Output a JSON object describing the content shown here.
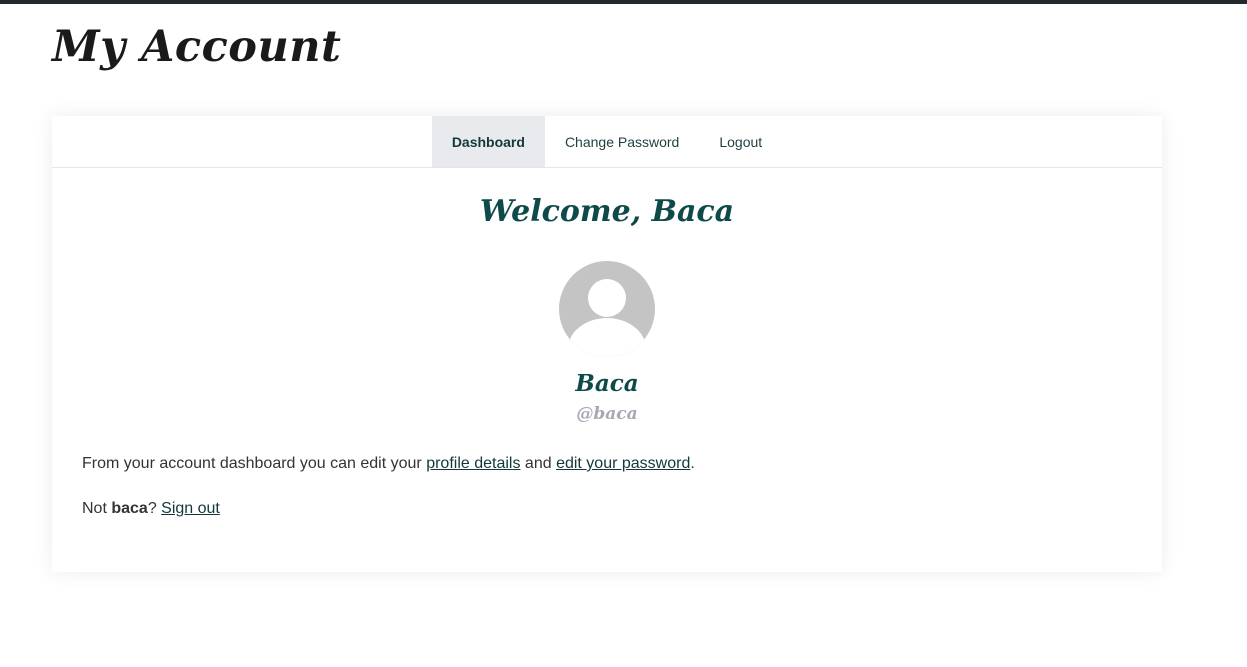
{
  "page": {
    "title": "My Account"
  },
  "tabs": [
    {
      "label": "Dashboard",
      "active": true
    },
    {
      "label": "Change Password",
      "active": false
    },
    {
      "label": "Logout",
      "active": false
    }
  ],
  "dashboard": {
    "welcome": "Welcome, Baca",
    "avatar_icon": "default-user-avatar-icon",
    "display_name": "Baca",
    "username": "@baca",
    "intro_before": "From your account dashboard you can edit your ",
    "profile_link": "profile details",
    "intro_middle": " and ",
    "password_link": "edit your password",
    "intro_after": ".",
    "not_prefix": "Not ",
    "not_user": "baca",
    "not_suffix": "? ",
    "signout_link": "Sign out"
  },
  "colors": {
    "accent": "#0f4a4a",
    "link": "#12383a",
    "tab_active_bg": "#e9eaee",
    "username": "#a8a8b3",
    "avatar_bg": "#c4c4c4",
    "topbar": "#23282d"
  }
}
